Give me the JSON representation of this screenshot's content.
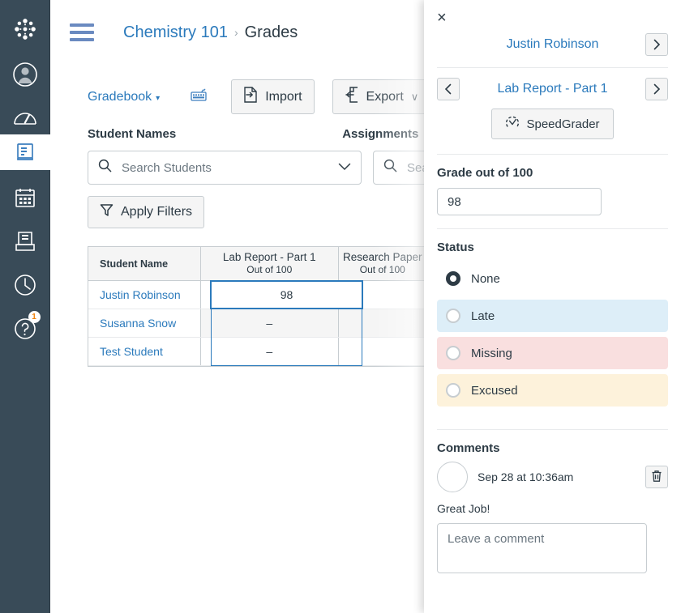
{
  "colors": {
    "nav_bg": "#394B58",
    "link_blue": "#2B7ABC",
    "text_dark": "#2D3B45",
    "border": "#C7CDD1",
    "late_bg": "#DDEEF8",
    "missing_bg": "#F9DFDF",
    "excused_bg": "#FDF2DB",
    "badge_orange": "#F0820C"
  },
  "globalnav": {
    "items": [
      {
        "name": "canvas-logo-icon",
        "label": "Canvas"
      },
      {
        "name": "account-icon",
        "label": "Account"
      },
      {
        "name": "dashboard-icon",
        "label": "Dashboard"
      },
      {
        "name": "courses-icon",
        "label": "Courses"
      },
      {
        "name": "calendar-icon",
        "label": "Calendar"
      },
      {
        "name": "inbox-icon",
        "label": "Inbox"
      },
      {
        "name": "history-icon",
        "label": "History"
      },
      {
        "name": "help-icon",
        "label": "Help"
      }
    ],
    "help_badge": "1"
  },
  "header": {
    "menu_icon": "hamburger-icon",
    "breadcrumb": {
      "course": "Chemistry 101",
      "separator": "›",
      "current": "Grades"
    }
  },
  "toolbar": {
    "gradebook_menu": "Gradebook",
    "gradebook_caret": "▾",
    "keyboard_icon": "keyboard-icon",
    "import_label": "Import",
    "export_label": "Export",
    "export_caret": "∨"
  },
  "filters": {
    "student_names_heading": "Student Names",
    "assignments_heading": "Assignments",
    "student_search_placeholder": "Search Students",
    "assignment_search_placeholder": "Search Assignments",
    "apply_filters_label": "Apply Filters"
  },
  "gradebook": {
    "columns": [
      {
        "title": "Student Name",
        "sub": ""
      },
      {
        "title": "Lab Report - Part 1",
        "sub": "Out of 100"
      },
      {
        "title": "Research Paper",
        "sub": "Out of 100"
      }
    ],
    "rows": [
      {
        "student": "Justin Robinson",
        "lab_report": "98",
        "research": ""
      },
      {
        "student": "Susanna Snow",
        "lab_report": "–",
        "research": ""
      },
      {
        "student": "Test Student",
        "lab_report": "–",
        "research": ""
      }
    ]
  },
  "tray": {
    "close_label": "×",
    "student": {
      "name": "Justin Robinson",
      "next_label": "›"
    },
    "assignment": {
      "prev_label": "‹",
      "name": "Lab Report - Part 1",
      "next_label": "›"
    },
    "speedgrader_label": "SpeedGrader",
    "grade": {
      "label": "Grade out of 100",
      "value": "98"
    },
    "status": {
      "label": "Status",
      "options": [
        {
          "label": "None",
          "selected": true
        },
        {
          "label": "Late",
          "selected": false
        },
        {
          "label": "Missing",
          "selected": false
        },
        {
          "label": "Excused",
          "selected": false
        }
      ]
    },
    "comments": {
      "heading": "Comments",
      "items": [
        {
          "date": "Sep 28 at 10:36am",
          "body": "Great Job!"
        }
      ],
      "new_comment_placeholder": "Leave a comment"
    }
  }
}
